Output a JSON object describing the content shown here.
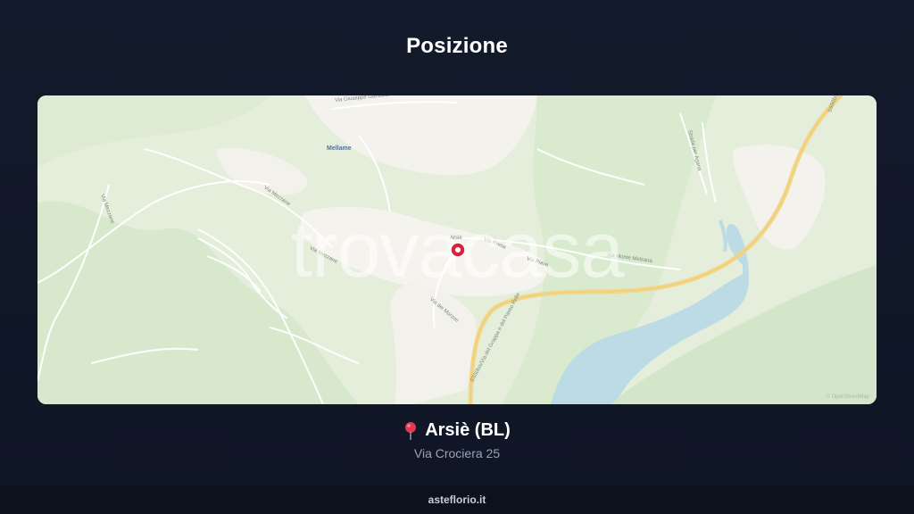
{
  "header": {
    "title": "Posizione"
  },
  "map": {
    "watermark": "trovacasa",
    "town_label": "Mellame",
    "center_label": "Arsiè",
    "attribution": "© OpenStreetMap",
    "streets": [
      "Via Giuseppe Garibaldi",
      "Via Mezzane",
      "Via Mezzane",
      "Via Mezzane",
      "Via Roma",
      "Via Piave",
      "Via Monte Melzana",
      "Via dei Morzeri",
      "SS50bis/Via del Grappa e del Passo Rolle",
      "Strada per Agana",
      "SS50bis"
    ]
  },
  "location": {
    "pin_icon": "map-pin-icon",
    "name": "Arsiè (BL)",
    "address": "Via Crociera 25"
  },
  "footer": {
    "site": "asteflorio.it"
  },
  "colors": {
    "background": "#111827",
    "map_land": "#e6f0de",
    "water": "#bfdde6",
    "road_major": "#f3d98a",
    "pin": "#e02d4a"
  }
}
